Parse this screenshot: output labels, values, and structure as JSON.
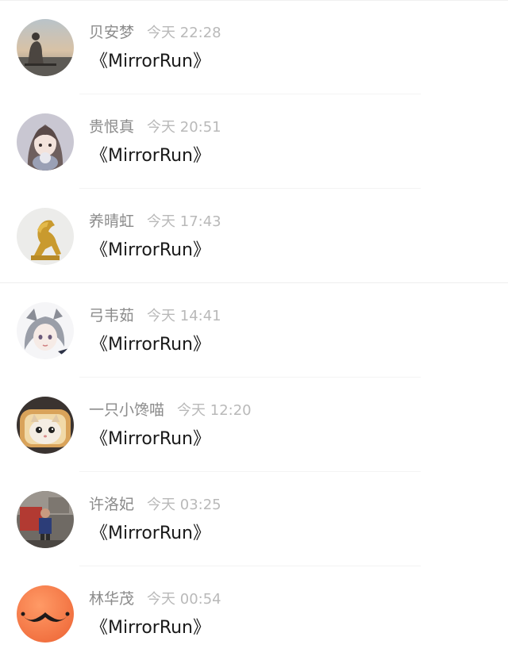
{
  "comments": [
    {
      "name": "贝安梦",
      "time": "今天 22:28",
      "message": "《MirrorRun》",
      "avatar": "person-sunset-avatar"
    },
    {
      "name": "贵恨真",
      "time": "今天 20:51",
      "message": "《MirrorRun》",
      "avatar": "anime-girl-avatar"
    },
    {
      "name": "养晴虹",
      "time": "今天 17:43",
      "message": "《MirrorRun》",
      "avatar": "golden-horse-avatar"
    },
    {
      "name": "弓韦茹",
      "time": "今天 14:41",
      "message": "《MirrorRun》",
      "avatar": "cat-ear-girl-avatar"
    },
    {
      "name": "一只小馋喵",
      "time": "今天 12:20",
      "message": "《MirrorRun》",
      "avatar": "bread-cat-avatar"
    },
    {
      "name": "许洛妃",
      "time": "今天 03:25",
      "message": "《MirrorRun》",
      "avatar": "child-photo-avatar"
    },
    {
      "name": "林华茂",
      "time": "今天 00:54",
      "message": "《MirrorRun》",
      "avatar": "mustache-avatar"
    }
  ]
}
